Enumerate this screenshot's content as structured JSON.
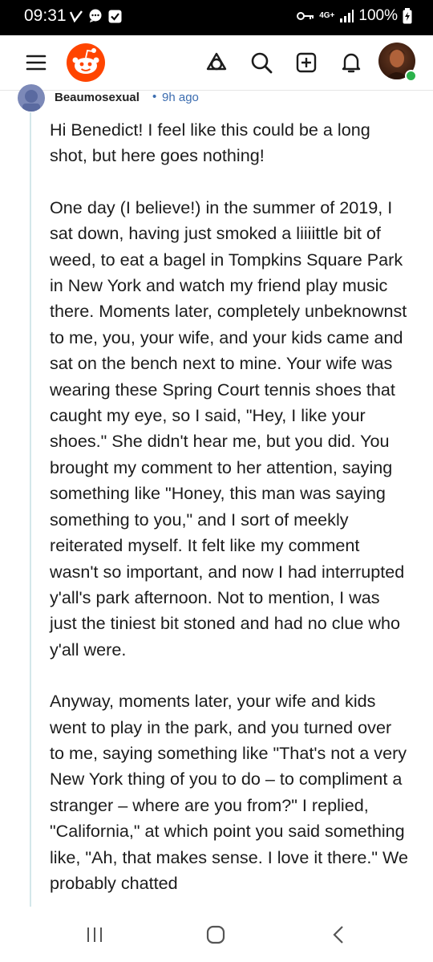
{
  "status_bar": {
    "time": "09:31",
    "battery": "100%",
    "network": "4G+"
  },
  "header": {
    "menu_icon": "hamburger-menu-icon",
    "logo": "reddit-logo",
    "icons": [
      "explore-icon",
      "search-icon",
      "create-post-icon",
      "notifications-icon"
    ]
  },
  "comment": {
    "username": "Beaumosexual",
    "separator": "•",
    "time_ago": "9h ago",
    "paragraphs": [
      "Hi Benedict! I feel like this could be a long shot, but here goes nothing!",
      "One day (I believe!) in the summer of 2019, I sat down, having just smoked a liiiittle bit of weed, to eat a bagel in Tompkins Square Park in New York and watch my friend play music there. Moments later, completely unbeknownst to me, you, your wife, and your kids came and sat on the bench next to mine. Your wife was wearing these Spring Court tennis shoes that caught my eye, so I said, \"Hey, I like your shoes.\" She didn't hear me, but you did. You brought my comment to her attention, saying something like \"Honey, this man was saying something to you,\" and I sort of meekly reiterated myself. It felt like my comment wasn't so important, and now I had interrupted y'all's park afternoon. Not to mention, I was just the tiniest bit stoned and had no clue who y'all were.",
      "Anyway, moments later, your wife and kids went to play in the park, and you turned over to me, saying something like \"That's not a very New York thing of you to do – to compliment a stranger – where are you from?\" I replied, \"California,\" at which point you said something like, \"Ah, that makes sense. I love it there.\" We probably chatted"
    ]
  },
  "colors": {
    "reddit_orange": "#ff4500",
    "link_blue": "#3c6db0",
    "thread_line": "#d3e7ea",
    "online_green": "#2bb24c"
  }
}
